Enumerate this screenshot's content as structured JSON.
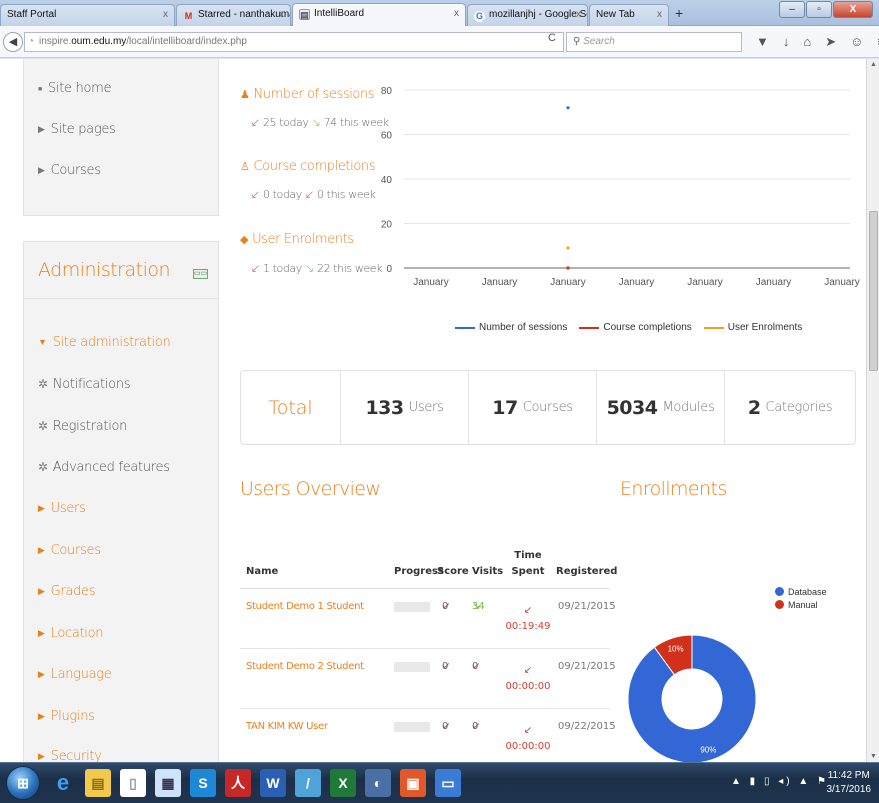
{
  "browser": {
    "tabs": [
      {
        "label": "Staff Portal",
        "icon": "none"
      },
      {
        "label": "Starred - nanthakumar@o...",
        "icon": "gmail-icon"
      },
      {
        "label": "IntelliBoard",
        "icon": "intelliboard-icon"
      },
      {
        "label": "mozillanjhj - Google Search",
        "icon": "google-icon"
      },
      {
        "label": "New Tab",
        "icon": "none"
      }
    ],
    "url_prefix": "inspire.",
    "url_domain": "oum.edu.my",
    "url_path": "/local/intelliboard/index.php",
    "search_placeholder": "Search"
  },
  "sidebar": {
    "nav_items": [
      {
        "label": "Site home"
      },
      {
        "label": "Site pages"
      },
      {
        "label": "Courses"
      }
    ],
    "admin_title": "Administration",
    "site_admin": "Site administration",
    "admin_items": [
      {
        "label": "Notifications"
      },
      {
        "label": "Registration"
      },
      {
        "label": "Advanced features"
      },
      {
        "label": "Users"
      },
      {
        "label": "Courses"
      },
      {
        "label": "Grades"
      },
      {
        "label": "Location"
      },
      {
        "label": "Language"
      },
      {
        "label": "Plugins"
      },
      {
        "label": "Security"
      }
    ]
  },
  "stats": [
    {
      "title": "Number of sessions",
      "today": "25 today",
      "week": "74 this week"
    },
    {
      "title": "Course completions",
      "today": "0 today",
      "week": "0 this week"
    },
    {
      "title": "User Enrolments",
      "today": "1 today",
      "week": "22 this week"
    }
  ],
  "chart_data": {
    "type": "line",
    "y_ticks": [
      0,
      20,
      40,
      60,
      80
    ],
    "ylim": [
      0,
      80
    ],
    "x_ticks": [
      "January",
      "January",
      "January",
      "January",
      "January",
      "January",
      "January"
    ],
    "grid": true,
    "legend_position": "bottom",
    "series": [
      {
        "name": "Number of sessions",
        "color": "#2f6fc8",
        "points": [
          {
            "x_index": 2,
            "y": 72
          }
        ]
      },
      {
        "name": "Course completions",
        "color": "#d0311b",
        "points": [
          {
            "x_index": 2,
            "y": 0
          }
        ]
      },
      {
        "name": "User Enrolments",
        "color": "#f0a020",
        "points": [
          {
            "x_index": 2,
            "y": 9
          }
        ]
      }
    ]
  },
  "totals": {
    "label": "Total",
    "users_value": "133",
    "users_label": "Users",
    "courses_value": "17",
    "courses_label": "Courses",
    "modules_value": "5034",
    "modules_label": "Modules",
    "categories_value": "2",
    "categories_label": "Categories"
  },
  "users_overview": {
    "title": "Users Overview",
    "headers": {
      "name": "Name",
      "progress": "Progress",
      "score": "Score",
      "visits": "Visits",
      "time_spent_1": "Time",
      "time_spent_2": "Spent",
      "registered": "Registered"
    },
    "rows": [
      {
        "name": "Student Demo 1 Student",
        "progress": 0,
        "score": "0",
        "visits": "34",
        "time": "00:19:49",
        "registered": "09/21/2015"
      },
      {
        "name": "Student Demo 2 Student",
        "progress": 0,
        "score": "0",
        "visits": "0",
        "time": "00:00:00",
        "registered": "09/21/2015"
      },
      {
        "name": "TAN KIM KW User",
        "progress": 0,
        "score": "0",
        "visits": "0",
        "time": "00:00:00",
        "registered": "09/22/2015"
      }
    ]
  },
  "enrollments": {
    "title": "Enrollments",
    "chart": {
      "type": "pie",
      "slices": [
        {
          "name": "Database",
          "value": 90,
          "label": "90%",
          "color": "#3467d6"
        },
        {
          "name": "Manual",
          "value": 10,
          "label": "10%",
          "color": "#d0311b"
        }
      ]
    }
  },
  "taskbar": {
    "time": "11:42 PM",
    "date": "3/17/2016"
  }
}
